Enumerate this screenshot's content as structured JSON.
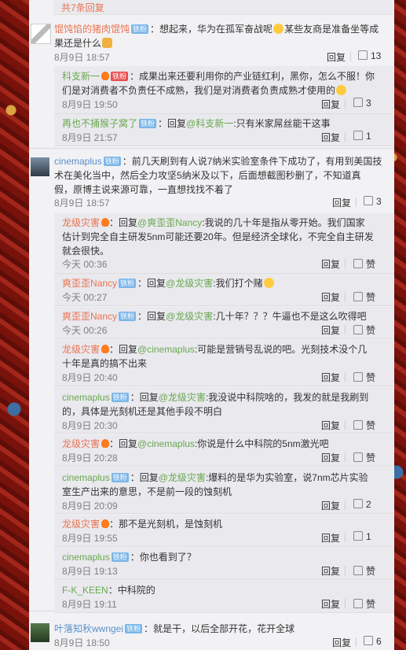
{
  "top": {
    "more_link": "共7条回复"
  },
  "ui": {
    "reply": "回复",
    "like": "赞",
    "badge": "铁粉",
    "separator": "："
  },
  "comments": [
    {
      "user": "馄饨馅的猪肉馄饨",
      "text_lines": [
        "想起来，华为在孤军奋战呢",
        "某些友商是准备坐等成",
        "果还是什么"
      ],
      "time": "8月9日 18:57",
      "likes": "13",
      "replies": [
        {
          "user": "科支新一",
          "line1": "成果出来还要利用你的产业链红利，黑你，怎么不服！你",
          "line2": "们是对消费者不负责任不成熟，我们是对消费者负责成熟才使用的",
          "time": "8月9日 19:50",
          "likes": "3"
        },
        {
          "user": "再也不捅猴子窝了",
          "prefix": "回复",
          "mention": "@科支新一",
          "text": ":只有米家屌丝能干这事",
          "time": "8月9日 21:57",
          "likes": "1"
        }
      ]
    },
    {
      "user": "cinemaplus",
      "text_lines": [
        "前几天刷到有人说7纳米实验室条件下成功了，有用到美国技",
        "术在美化当中，然后全力攻坚5纳米及以下，后面想截图秒删了，不知道真",
        "假，原博主说来源可靠，一直想找找不着了"
      ],
      "time": "8月9日 18:57",
      "likes": "3",
      "replies": [
        {
          "user": "龙级灾害",
          "prefix": "回复",
          "mention": "@爽歪歪Nancy",
          "line1": ":我说的几十年是指从零开始。我们国家",
          "line2": "估计到完全自主研发5nm可能还要20年。但是经济全球化，不完全自主研发",
          "line3": "就会很快。",
          "time": "今天 00:36",
          "likes": "赞"
        },
        {
          "user": "爽歪歪Nancy",
          "prefix": "回复",
          "mention": "@龙级灾害",
          "text": ":我们打个赌",
          "time": "今天 00:27",
          "likes": "赞"
        },
        {
          "user": "爽歪歪Nancy",
          "prefix": "回复",
          "mention": "@龙级灾害",
          "text": ":几十年？？？牛逼也不是这么吹得吧",
          "time": "今天 00:26",
          "likes": "赞"
        },
        {
          "user": "龙级灾害",
          "prefix": "回复",
          "mention": "@cinemaplus",
          "line1": ":可能是营销号乱说的吧。光刻技术没个几",
          "line2": "十年是真的搞不出来",
          "time": "8月9日 20:40",
          "likes": "赞"
        },
        {
          "user": "cinemaplus",
          "prefix": "回复",
          "mention": "@龙级灾害",
          "line1": ":我没说中科院啥的，我发的就是我刷到",
          "line2": "的，具体是光刻机还是其他手段不明白",
          "time": "8月9日 20:30",
          "likes": "赞"
        },
        {
          "user": "龙级灾害",
          "prefix": "回复",
          "mention": "@cinemaplus",
          "text": ":你说是什么中科院的5nm激光吧",
          "time": "8月9日 20:28",
          "likes": "赞"
        },
        {
          "user": "cinemaplus",
          "prefix": "回复",
          "mention": "@龙级灾害",
          "line1": ":爆料的是华为实验室，说7nm芯片实验",
          "line2": "室生产出来的意思，不是前一段的蚀刻机",
          "time": "8月9日 20:09",
          "likes": "2"
        },
        {
          "user": "龙级灾害",
          "text": "那不是光刻机，是蚀刻机",
          "time": "8月9日 19:55",
          "likes": "1"
        },
        {
          "user": "cinemaplus",
          "text": "你也看到了？",
          "time": "8月9日 19:13",
          "likes": "赞"
        },
        {
          "user": "F-K_KEEN",
          "text": "中科院的",
          "time": "8月9日 19:11",
          "likes": "赞"
        }
      ]
    },
    {
      "user": "叶落知秋wwngei",
      "text_lines": [
        "就是干，以后全部开花，花开全球"
      ],
      "time": "8月9日 18:50",
      "likes": "6"
    }
  ]
}
